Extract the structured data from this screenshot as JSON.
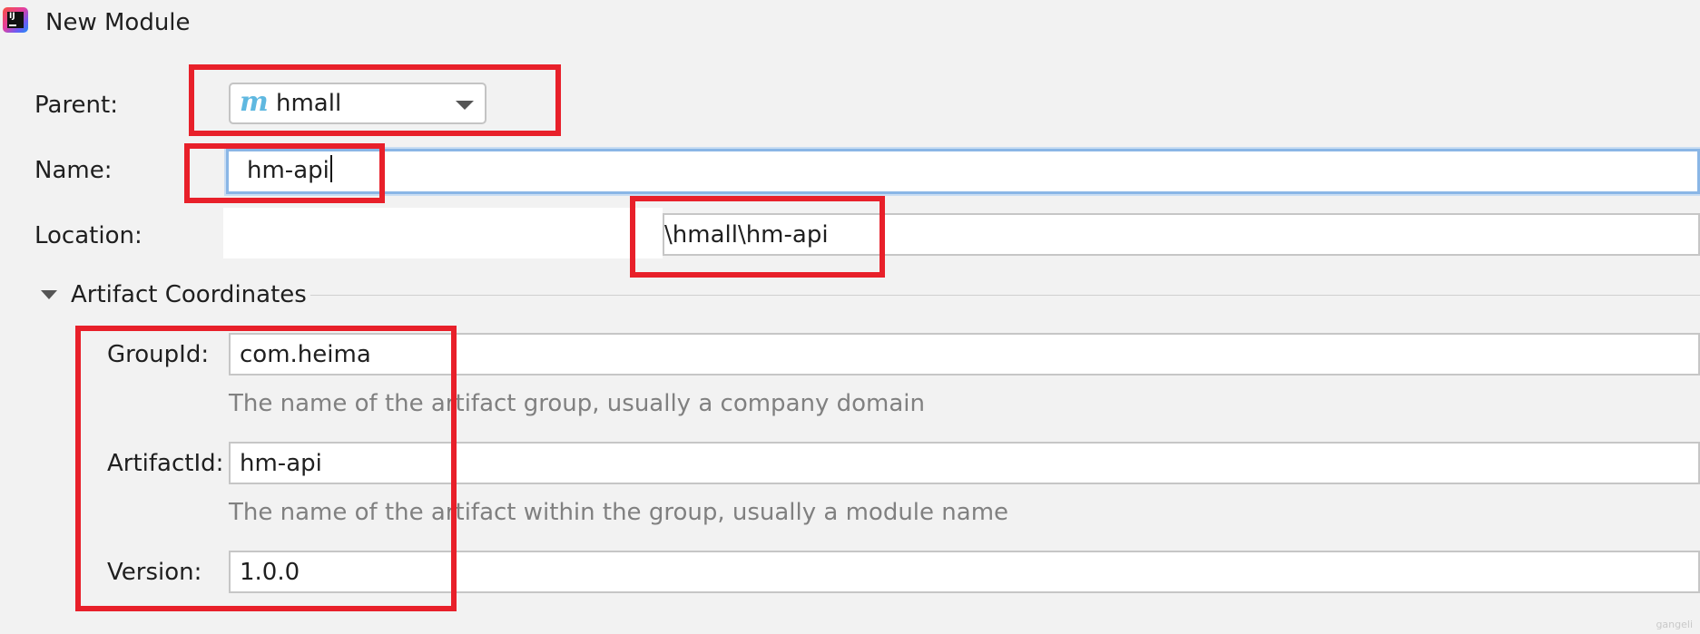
{
  "window": {
    "title": "New Module",
    "logo_icon": "intellij-idea-icon",
    "logo_text": "IJ"
  },
  "form": {
    "parent": {
      "label": "Parent:",
      "value": "hmall",
      "icon": "maven-m-icon",
      "icon_text": "m"
    },
    "name": {
      "label": "Name:",
      "value": "hm-api"
    },
    "location": {
      "label": "Location:",
      "value": "\\hmall\\hm-api"
    }
  },
  "artifact": {
    "section_title": "Artifact Coordinates",
    "group_id": {
      "label": "GroupId:",
      "value": "com.heima",
      "hint": "The name of the artifact group, usually a company domain"
    },
    "artifact_id": {
      "label": "ArtifactId:",
      "value": "hm-api",
      "hint": "The name of the artifact within the group, usually a module name"
    },
    "version": {
      "label": "Version:",
      "value": "1.0.0"
    }
  },
  "colors": {
    "annotation_red": "#e8202a",
    "focus_blue": "#8ab6e6",
    "maven_icon": "#5fb8e0",
    "background": "#f2f2f2"
  },
  "watermark": "gangeli"
}
